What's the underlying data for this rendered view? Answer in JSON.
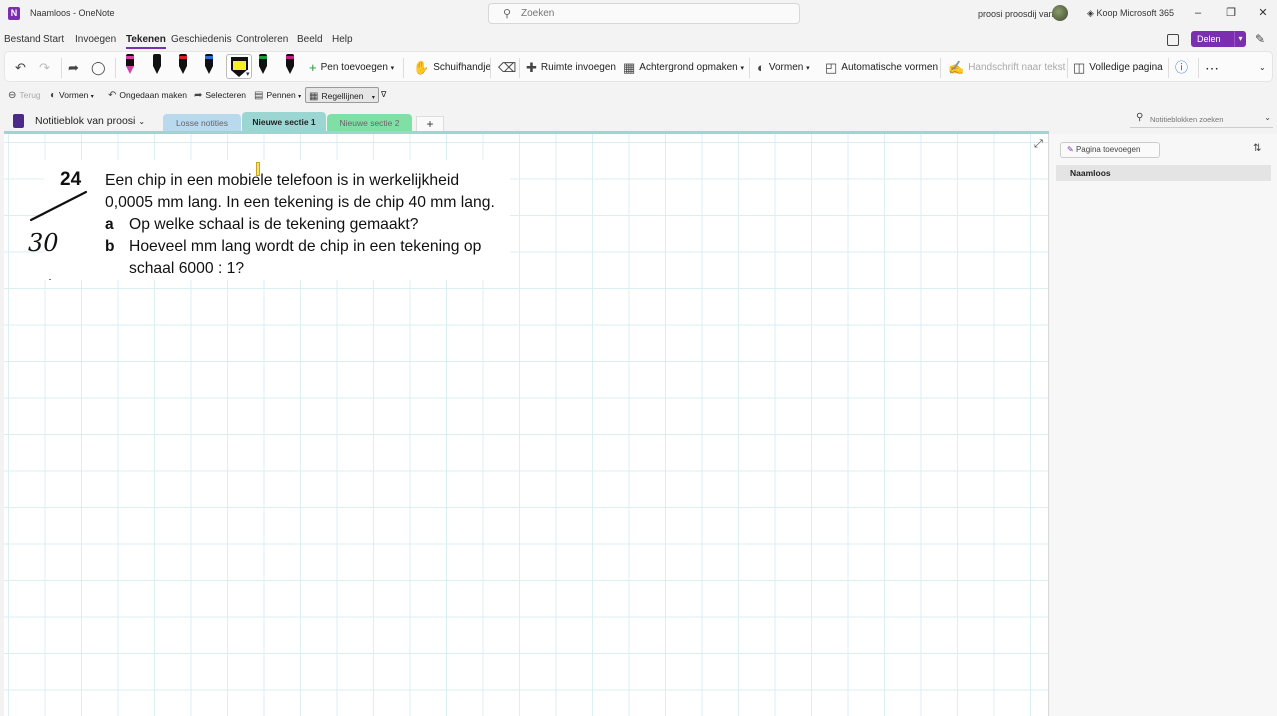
{
  "titlebar": {
    "doc_title": "Naamloos  -  OneNote",
    "search_placeholder": "Zoeken",
    "user_name": "proosi proosdij van",
    "buy_label": "Koop Microsoft 365",
    "icons": [
      "onenote-logo-icon",
      "search-icon",
      "avatar",
      "diamond-icon",
      "minimize-icon",
      "restore-icon",
      "close-icon"
    ]
  },
  "menubar": {
    "items": [
      "Bestand",
      "Start",
      "Invoegen",
      "Tekenen",
      "Geschiedenis",
      "Controleren",
      "Beeld",
      "Help"
    ],
    "active": "Tekenen",
    "share_label": "Delen"
  },
  "ribbon": {
    "add_pen": "Pen toevoegen",
    "hand": "Schuifhandje",
    "insert_space": "Ruimte invoegen",
    "background": "Achtergrond opmaken",
    "shapes": "Vormen",
    "auto_shapes": "Automatische vormen",
    "ink_to_text": "Handschrift naar tekst",
    "full_page": "Volledige pagina",
    "pen_colors": [
      "#d63fa6",
      "#111111",
      "#d32020",
      "#2a6fd6",
      "#f5f020",
      "#1d9a3a",
      "#c0208a"
    ]
  },
  "ribbon2": {
    "back": "Terug",
    "shapes": "Vormen",
    "undo": "Ongedaan maken",
    "select": "Selecteren",
    "pens": "Pennen",
    "rule_lines": "Regellijnen"
  },
  "sections": {
    "notebook_name": "Notitieblok van proosi",
    "tabs": [
      {
        "label": "Losse notities",
        "color": "#b9d9ef"
      },
      {
        "label": "Nieuwe sectie 1",
        "color": "#9cd6d3"
      },
      {
        "label": "Nieuwe sectie 2",
        "color": "#7fe0a6"
      }
    ],
    "add_tab": "+",
    "search_placeholder": "Notitieblokken zoeken"
  },
  "exercise": {
    "number": "24",
    "line1": "Een chip in een mobiele telefoon is in werkelijkheid",
    "line2": "0,0005 mm lang. In een tekening is de chip 40 mm lang.",
    "a_label": "a",
    "a_text": "Op welke schaal is de tekening gemaakt?",
    "b_label": "b",
    "b_text_1": "Hoeveel mm lang wordt de chip in een tekening op",
    "b_text_2": "schaal 6000 : 1?",
    "handwritten": "30"
  },
  "pages_pane": {
    "add_page": "Pagina toevoegen",
    "pages": [
      "Naamloos"
    ]
  }
}
